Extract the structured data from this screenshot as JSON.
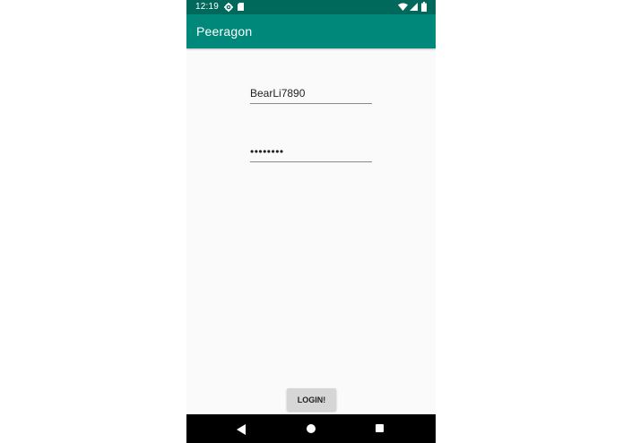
{
  "status_bar": {
    "time": "12:19",
    "icons": [
      "gear-icon",
      "sd-card-icon",
      "wifi-icon",
      "signal-icon",
      "battery-icon"
    ]
  },
  "app_bar": {
    "title": "Peeragon",
    "color": "#00897b",
    "status_color": "#00695c"
  },
  "login_form": {
    "username_value": "BearLi7890",
    "password_value": "••••••••",
    "login_label": "LOGIN!"
  },
  "nav_bar": {
    "icons": [
      "back-icon",
      "home-icon",
      "recents-icon"
    ]
  }
}
